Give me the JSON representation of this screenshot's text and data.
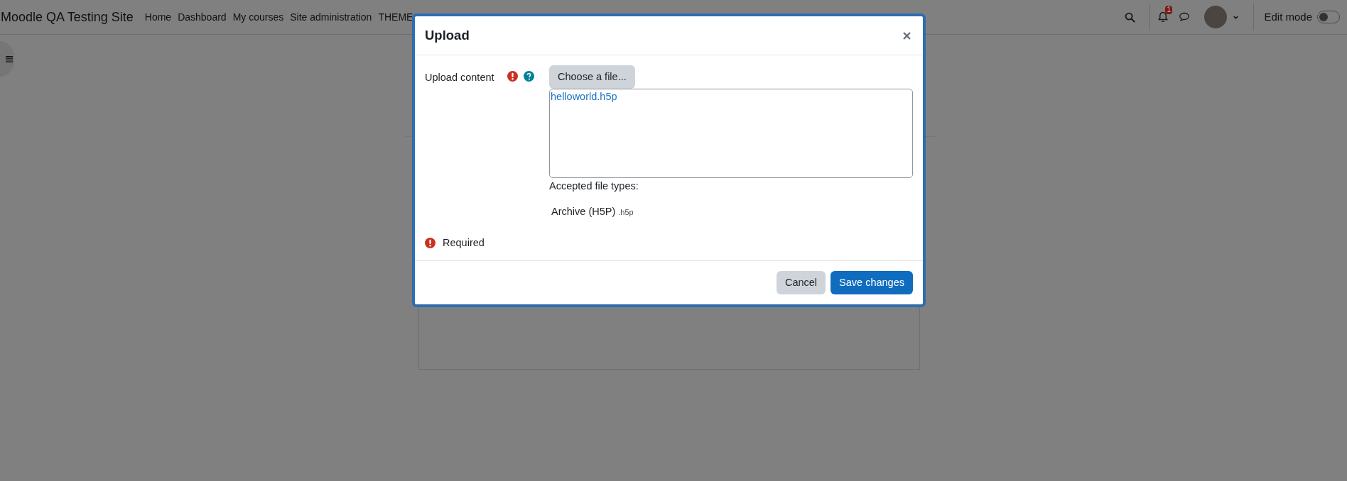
{
  "navbar": {
    "site_name": "Moodle QA Testing Site",
    "links": [
      "Home",
      "Dashboard",
      "My courses",
      "Site administration",
      "THEME"
    ],
    "notification_count": "1",
    "edit_mode": {
      "label": "Edit mode",
      "on": false
    }
  },
  "dialog": {
    "title": "Upload",
    "field_label": "Upload content",
    "choose_button": "Choose a file...",
    "files": [
      "helloworld.h5p"
    ],
    "accepted_label": "Accepted file types:",
    "accepted_types": [
      {
        "name": "Archive (H5P)",
        "extension": ".h5p"
      }
    ],
    "required_note": "Required",
    "buttons": [
      {
        "label": "Cancel",
        "kind": "secondary"
      },
      {
        "label": "Save changes",
        "kind": "primary"
      }
    ]
  }
}
